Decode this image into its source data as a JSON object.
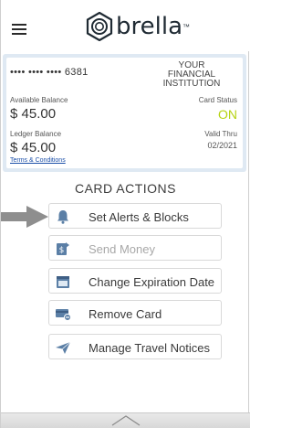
{
  "header": {
    "logo_text": "brella",
    "logo_tm": "™"
  },
  "card": {
    "masked_number": "•••• •••• •••• 6381",
    "institution_line1": "YOUR",
    "institution_line2": "FINANCIAL",
    "institution_line3": "INSTITUTION",
    "available_label": "Available Balance",
    "available_value": "$ 45.00",
    "status_label": "Card Status",
    "status_value": "ON",
    "ledger_label": "Ledger Balance",
    "ledger_value": "$ 45.00",
    "valid_label": "Valid Thru",
    "valid_value": "02/2021",
    "terms_link": "Terms & Conditions",
    "status_color": "#b6d313"
  },
  "actions": {
    "title": "CARD ACTIONS",
    "items": [
      {
        "label": "Set Alerts & Blocks",
        "icon": "bell-icon",
        "enabled": true
      },
      {
        "label": "Send Money",
        "icon": "send-money-icon",
        "enabled": false
      },
      {
        "label": "Change Expiration Date",
        "icon": "calendar-icon",
        "enabled": true
      },
      {
        "label": "Remove Card",
        "icon": "remove-card-icon",
        "enabled": true
      },
      {
        "label": "Manage Travel Notices",
        "icon": "paper-plane-icon",
        "enabled": true
      }
    ]
  },
  "colors": {
    "icon_blue": "#5b7fa6",
    "card_bg": "#dfe9f3",
    "link": "#1a4ea8"
  }
}
